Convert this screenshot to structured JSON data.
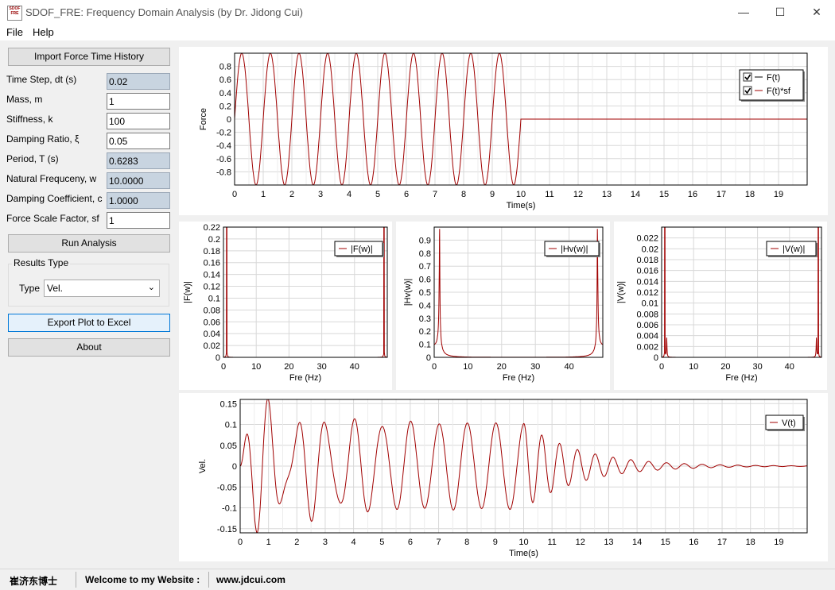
{
  "window": {
    "title": "SDOF_FRE: Frequency Domain Analysis (by Dr. Jidong Cui)",
    "icon_text": "SDOF FRE",
    "minimize": "—",
    "maximize": "☐",
    "close": "✕"
  },
  "menu": {
    "file": "File",
    "help": "Help"
  },
  "left": {
    "import_button": "Import Force Time History",
    "fields": [
      {
        "label": "Time Step, dt (s)",
        "value": "0.02",
        "readonly": true
      },
      {
        "label": "Mass, m",
        "value": "1",
        "readonly": false
      },
      {
        "label": "Stiffness, k",
        "value": "100",
        "readonly": false
      },
      {
        "label": "Damping Ratio, ξ",
        "value": "0.05",
        "readonly": false
      },
      {
        "label": "Period, T (s)",
        "value": "0.6283",
        "readonly": true
      },
      {
        "label": "Natural Frequceny, w",
        "value": "10.0000",
        "readonly": true
      },
      {
        "label": "Damping Coefficient, c",
        "value": "1.0000",
        "readonly": true
      },
      {
        "label": "Force Scale Factor, sf",
        "value": "1",
        "readonly": false
      }
    ],
    "run_button": "Run Analysis",
    "results_group": "Results Type",
    "type_label": "Type",
    "type_value": "Vel.",
    "export_button": "Export Plot to Excel",
    "about_button": "About"
  },
  "status": {
    "left": "崔济东博士",
    "welcome": "Welcome to my Website :",
    "url": "www.jdcui.com"
  },
  "chart_data": [
    {
      "id": "force",
      "type": "line",
      "xlabel": "Time(s)",
      "ylabel": "Force",
      "xlim": [
        0,
        20
      ],
      "ylim": [
        -1,
        1
      ],
      "xticks": [
        0,
        1,
        2,
        3,
        4,
        5,
        6,
        7,
        8,
        9,
        10,
        11,
        12,
        13,
        14,
        15,
        16,
        17,
        18,
        19
      ],
      "yticks": [
        -0.8,
        -0.6,
        -0.4,
        -0.2,
        0,
        0.2,
        0.4,
        0.6,
        0.8
      ],
      "legend": [
        {
          "name": "F(t)",
          "checked": true,
          "color": "#000000"
        },
        {
          "name": "F(t)*sf",
          "checked": true,
          "color": "#a00000"
        }
      ],
      "series": [
        {
          "name": "F(t)*sf",
          "color": "#a00000",
          "description": "sin(2π·t) for 0≤t≤10, 0 afterwards",
          "freq_hz": 1,
          "amplitude": 1,
          "end_time": 10
        }
      ]
    },
    {
      "id": "fw",
      "type": "line",
      "xlabel": "Fre (Hz)",
      "ylabel": "|F(w)|",
      "xlim": [
        0,
        50
      ],
      "ylim": [
        0,
        0.22
      ],
      "xticks": [
        0,
        10,
        20,
        30,
        40
      ],
      "yticks": [
        0,
        0.02,
        0.04,
        0.06,
        0.08,
        0.1,
        0.12,
        0.14,
        0.16,
        0.18,
        0.2,
        0.22
      ],
      "legend": [
        {
          "name": "|F(w)|",
          "color": "#a00000"
        }
      ],
      "series": [
        {
          "name": "|F(w)|",
          "color": "#a00000",
          "peak_x": [
            1,
            49
          ],
          "peak_y": 0.22
        }
      ]
    },
    {
      "id": "hw",
      "type": "line",
      "xlabel": "Fre (Hz)",
      "ylabel": "|Hv(w)|",
      "xlim": [
        0,
        50
      ],
      "ylim": [
        0,
        1
      ],
      "xticks": [
        0,
        10,
        20,
        30,
        40
      ],
      "yticks": [
        0,
        0.1,
        0.2,
        0.3,
        0.4,
        0.5,
        0.6,
        0.7,
        0.8,
        0.9
      ],
      "legend": [
        {
          "name": "|Hv(w)|",
          "color": "#a00000"
        }
      ],
      "series": [
        {
          "name": "|Hv(w)|",
          "color": "#a00000",
          "peak_x": [
            1.59,
            48.41
          ],
          "peak_y": 1
        }
      ]
    },
    {
      "id": "vw",
      "type": "line",
      "xlabel": "Fre (Hz)",
      "ylabel": "|V(w)|",
      "xlim": [
        0,
        50
      ],
      "ylim": [
        0,
        0.024
      ],
      "xticks": [
        0,
        10,
        20,
        30,
        40
      ],
      "yticks": [
        0,
        0.002,
        0.004,
        0.006,
        0.008,
        0.01,
        0.012,
        0.014,
        0.016,
        0.018,
        0.02,
        0.022
      ],
      "legend": [
        {
          "name": "|V(w)|",
          "color": "#a00000"
        }
      ],
      "series": [
        {
          "name": "|V(w)|",
          "color": "#a00000",
          "peak_x": [
            1,
            49
          ],
          "peak_y": 0.024
        }
      ]
    },
    {
      "id": "vt",
      "type": "line",
      "xlabel": "Time(s)",
      "ylabel": "Vel.",
      "xlim": [
        0,
        20
      ],
      "ylim": [
        -0.16,
        0.16
      ],
      "xticks": [
        0,
        1,
        2,
        3,
        4,
        5,
        6,
        7,
        8,
        9,
        10,
        11,
        12,
        13,
        14,
        15,
        16,
        17,
        18,
        19
      ],
      "yticks": [
        -0.15,
        -0.1,
        -0.05,
        0,
        0.05,
        0.1,
        0.15
      ],
      "legend": [
        {
          "name": "V(t)",
          "color": "#a00000"
        }
      ],
      "series": [
        {
          "name": "V(t)",
          "color": "#a00000",
          "description": "forced response at 1 Hz up to 10 s, then free decay at ~1.59 Hz",
          "steady_amplitude": 0.1,
          "peak": 0.16,
          "trough": -0.155,
          "decay_start": 10
        }
      ]
    }
  ]
}
